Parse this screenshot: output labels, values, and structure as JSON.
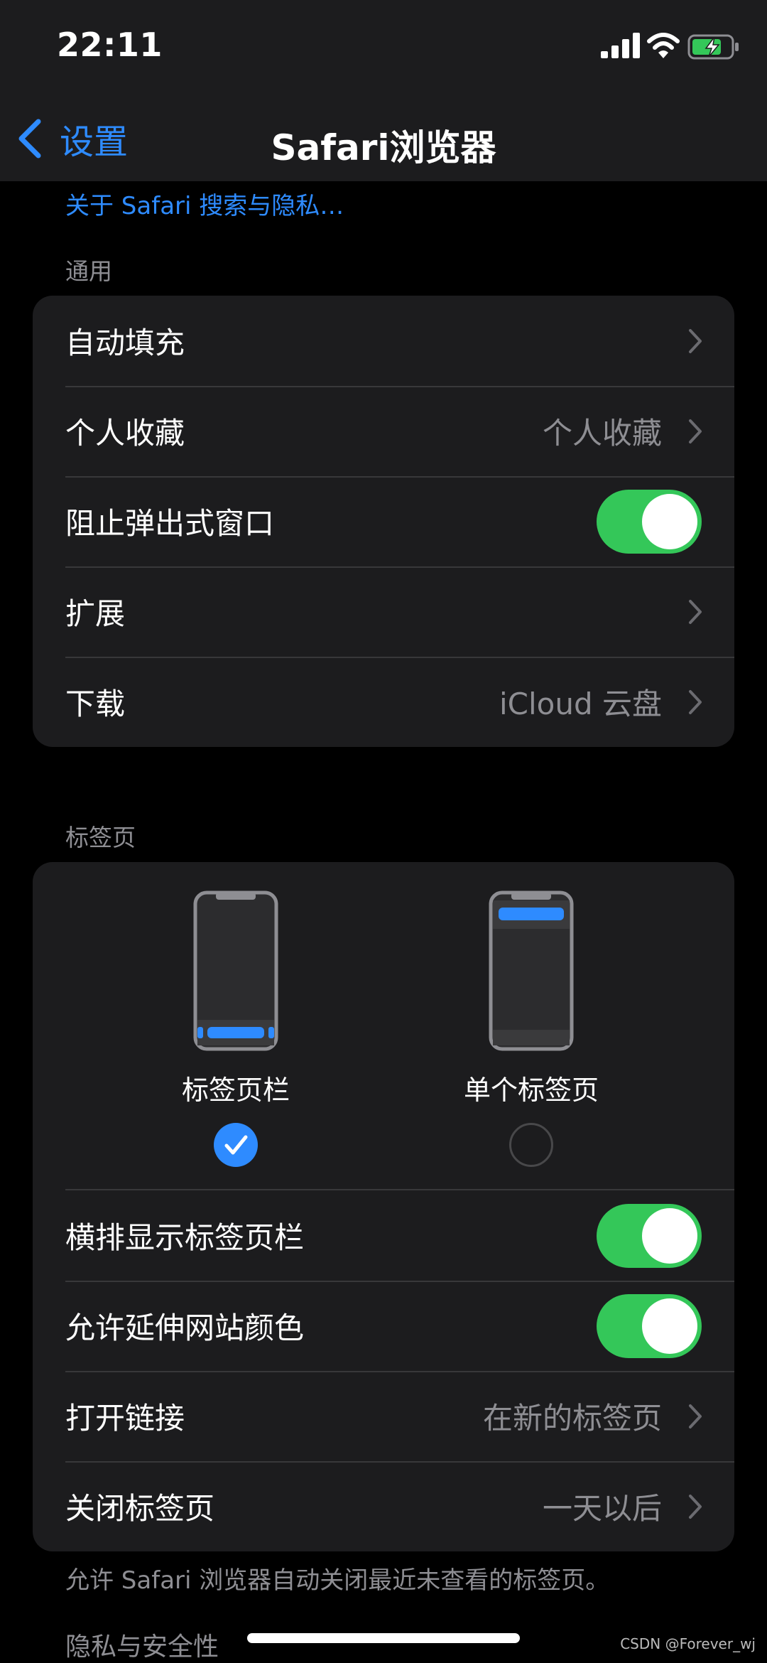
{
  "status_bar": {
    "time": "22:11",
    "icons": [
      "cellular-signal-icon",
      "wifi-icon",
      "battery-charging-icon"
    ]
  },
  "nav": {
    "back_label": "设置",
    "title": "Safari浏览器"
  },
  "about_link": "关于 Safari 搜索与隐私…",
  "general": {
    "header": "通用",
    "rows": [
      {
        "label": "自动填充",
        "value": ""
      },
      {
        "label": "个人收藏",
        "value": "个人收藏"
      },
      {
        "label": "阻止弹出式窗口",
        "toggle": true
      },
      {
        "label": "扩展",
        "value": ""
      },
      {
        "label": "下载",
        "value": "iCloud 云盘"
      }
    ]
  },
  "tabs": {
    "header": "标签页",
    "options": [
      {
        "label": "标签页栏",
        "selected": true
      },
      {
        "label": "单个标签页",
        "selected": false
      }
    ],
    "rows": [
      {
        "label": "横排显示标签页栏",
        "toggle": true
      },
      {
        "label": "允许延伸网站颜色",
        "toggle": true
      },
      {
        "label": "打开链接",
        "value": "在新的标签页"
      },
      {
        "label": "关闭标签页",
        "value": "一天以后"
      }
    ],
    "footer": "允许 Safari 浏览器自动关闭最近未查看的标签页。"
  },
  "privacy": {
    "header": "隐私与安全性"
  },
  "watermark": "CSDN @Forever_wj",
  "colors": {
    "accent": "#2e8bff",
    "toggle_on": "#34c759",
    "cell_bg": "#1c1c1e",
    "secondary_text": "#8e8e93"
  }
}
